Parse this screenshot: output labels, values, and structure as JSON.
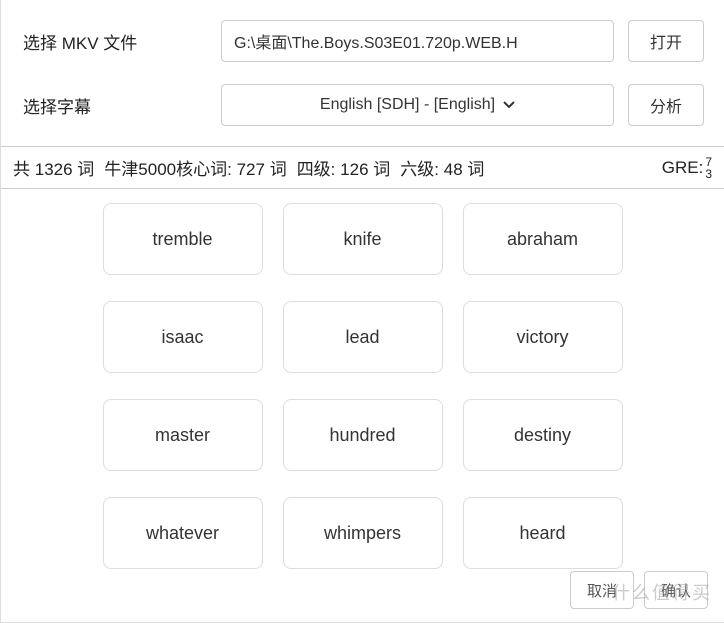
{
  "form": {
    "file_label": "选择 MKV 文件",
    "file_value": "G:\\桌面\\The.Boys.S03E01.720p.WEB.H",
    "open_btn": "打开",
    "subtitle_label": "选择字幕",
    "subtitle_value": "English [SDH] - [English]",
    "analyze_btn": "分析"
  },
  "stats": {
    "total_prefix": "共",
    "total_value": "1326",
    "total_suffix": "词",
    "oxford_label": "牛津5000核心词:",
    "oxford_value": "727",
    "oxford_suffix": "词",
    "cet4_label": "四级:",
    "cet4_value": "126",
    "cet4_suffix": "词",
    "cet6_label": "六级:",
    "cet6_value": "48",
    "cet6_suffix": "词",
    "gre_label": "GRE:",
    "gre_top": "7",
    "gre_bottom": "3"
  },
  "words": [
    "tremble",
    "knife",
    "abraham",
    "isaac",
    "lead",
    "victory",
    "master",
    "hundred",
    "destiny",
    "whatever",
    "whimpers",
    "heard"
  ],
  "footer": {
    "btn1": "取消",
    "btn2": "确认"
  },
  "watermark": "什么值得买"
}
